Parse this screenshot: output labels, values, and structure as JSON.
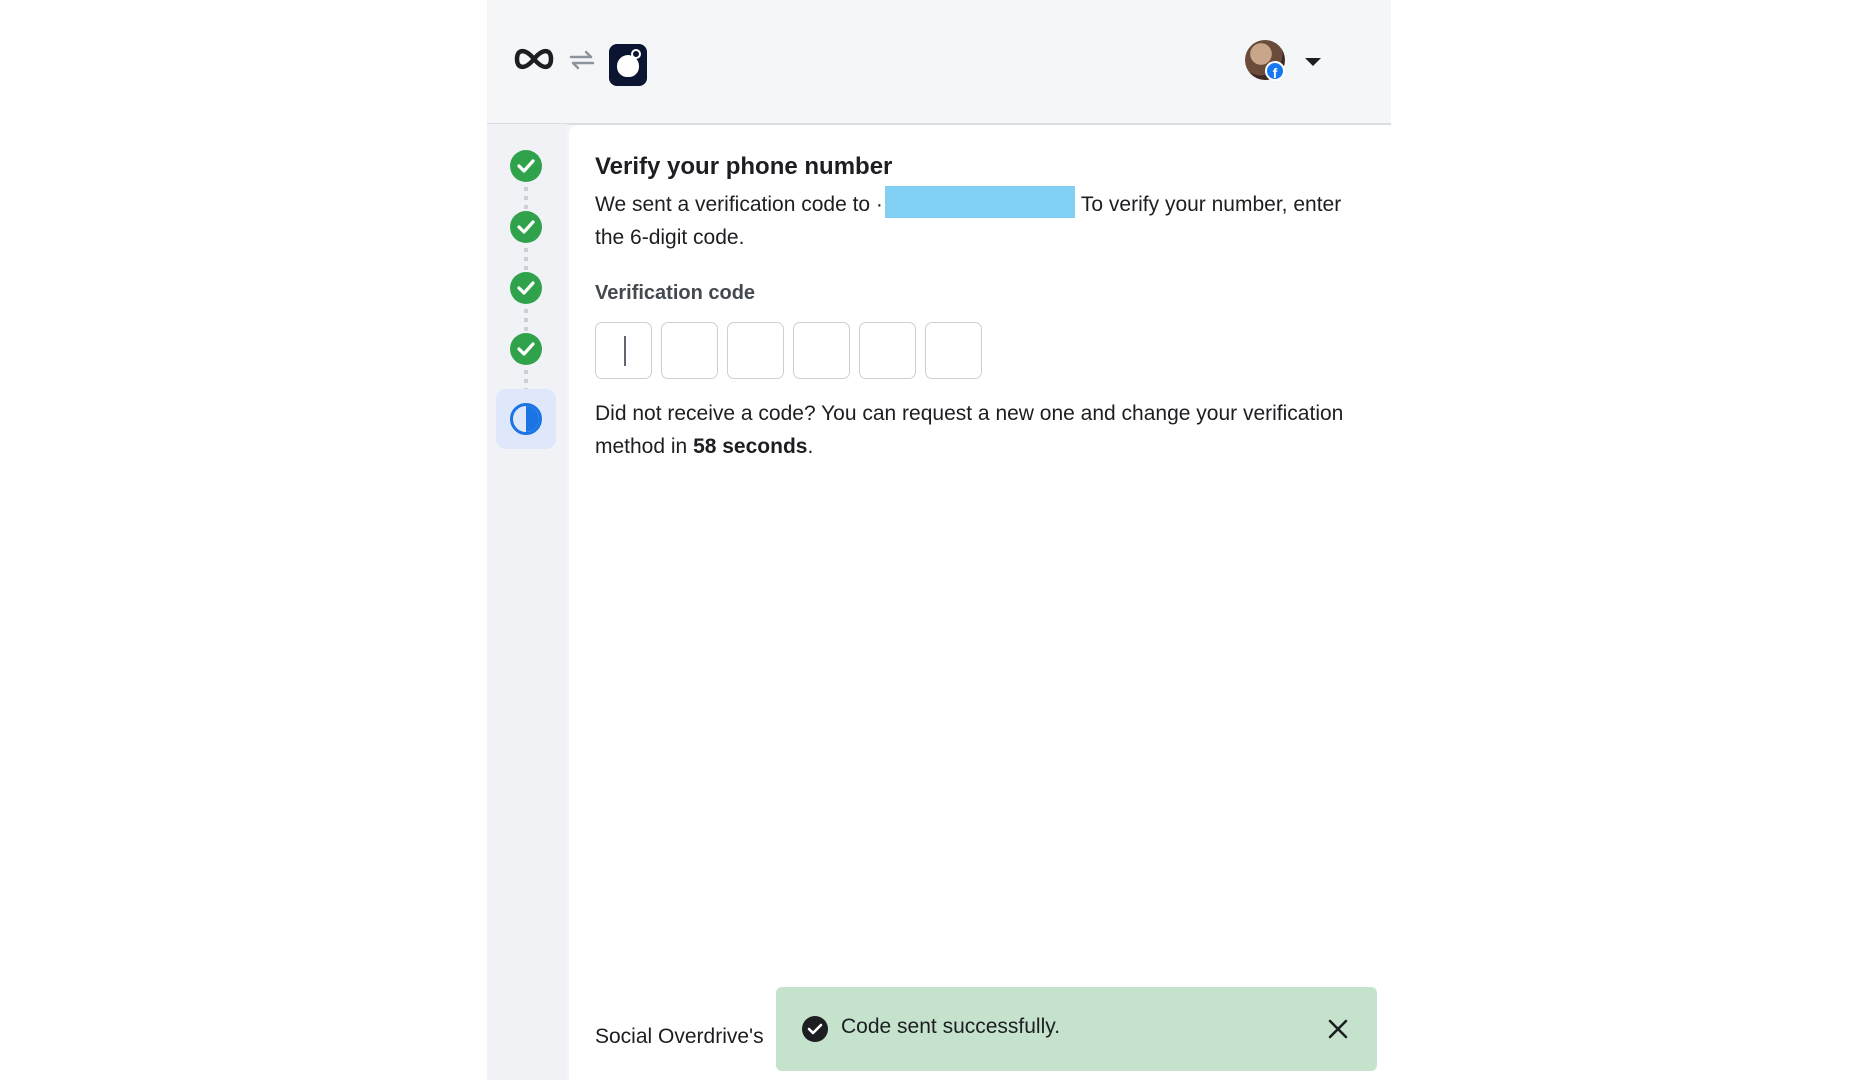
{
  "header": {
    "logo_icon": "meta-infinity-logo",
    "sync_icon": "sync-arrows-icon",
    "app_icon": "app-avatar-icon",
    "account_avatar": "user-avatar",
    "account_badge_icon": "facebook-badge-icon",
    "account_badge_label": "f",
    "menu_icon": "caret-down-icon"
  },
  "stepper": {
    "steps": [
      {
        "status": "complete",
        "icon": "check-circle-icon"
      },
      {
        "status": "complete",
        "icon": "check-circle-icon"
      },
      {
        "status": "complete",
        "icon": "check-circle-icon"
      },
      {
        "status": "complete",
        "icon": "check-circle-icon"
      },
      {
        "status": "current",
        "icon": "half-circle-icon"
      }
    ],
    "complete_color": "#31a24c",
    "current_color": "#1b74e4"
  },
  "main": {
    "title": "Verify your phone number",
    "description_before": "We sent a verification code to ·",
    "description_after": "To verify your number, enter the 6-digit code.",
    "code_label": "Verification code",
    "code_digits": [
      "",
      "",
      "",
      "",
      "",
      ""
    ],
    "resend_text": "Did not receive a code? You can request a new one and change your verification method in ",
    "resend_countdown": "58 seconds",
    "resend_suffix": ".",
    "footer_text": "Social Overdrive's"
  },
  "toast": {
    "message": "Code sent successfully.",
    "icon": "check-circle-filled-icon",
    "close_icon": "close-icon",
    "background": "#c4e2cc"
  }
}
